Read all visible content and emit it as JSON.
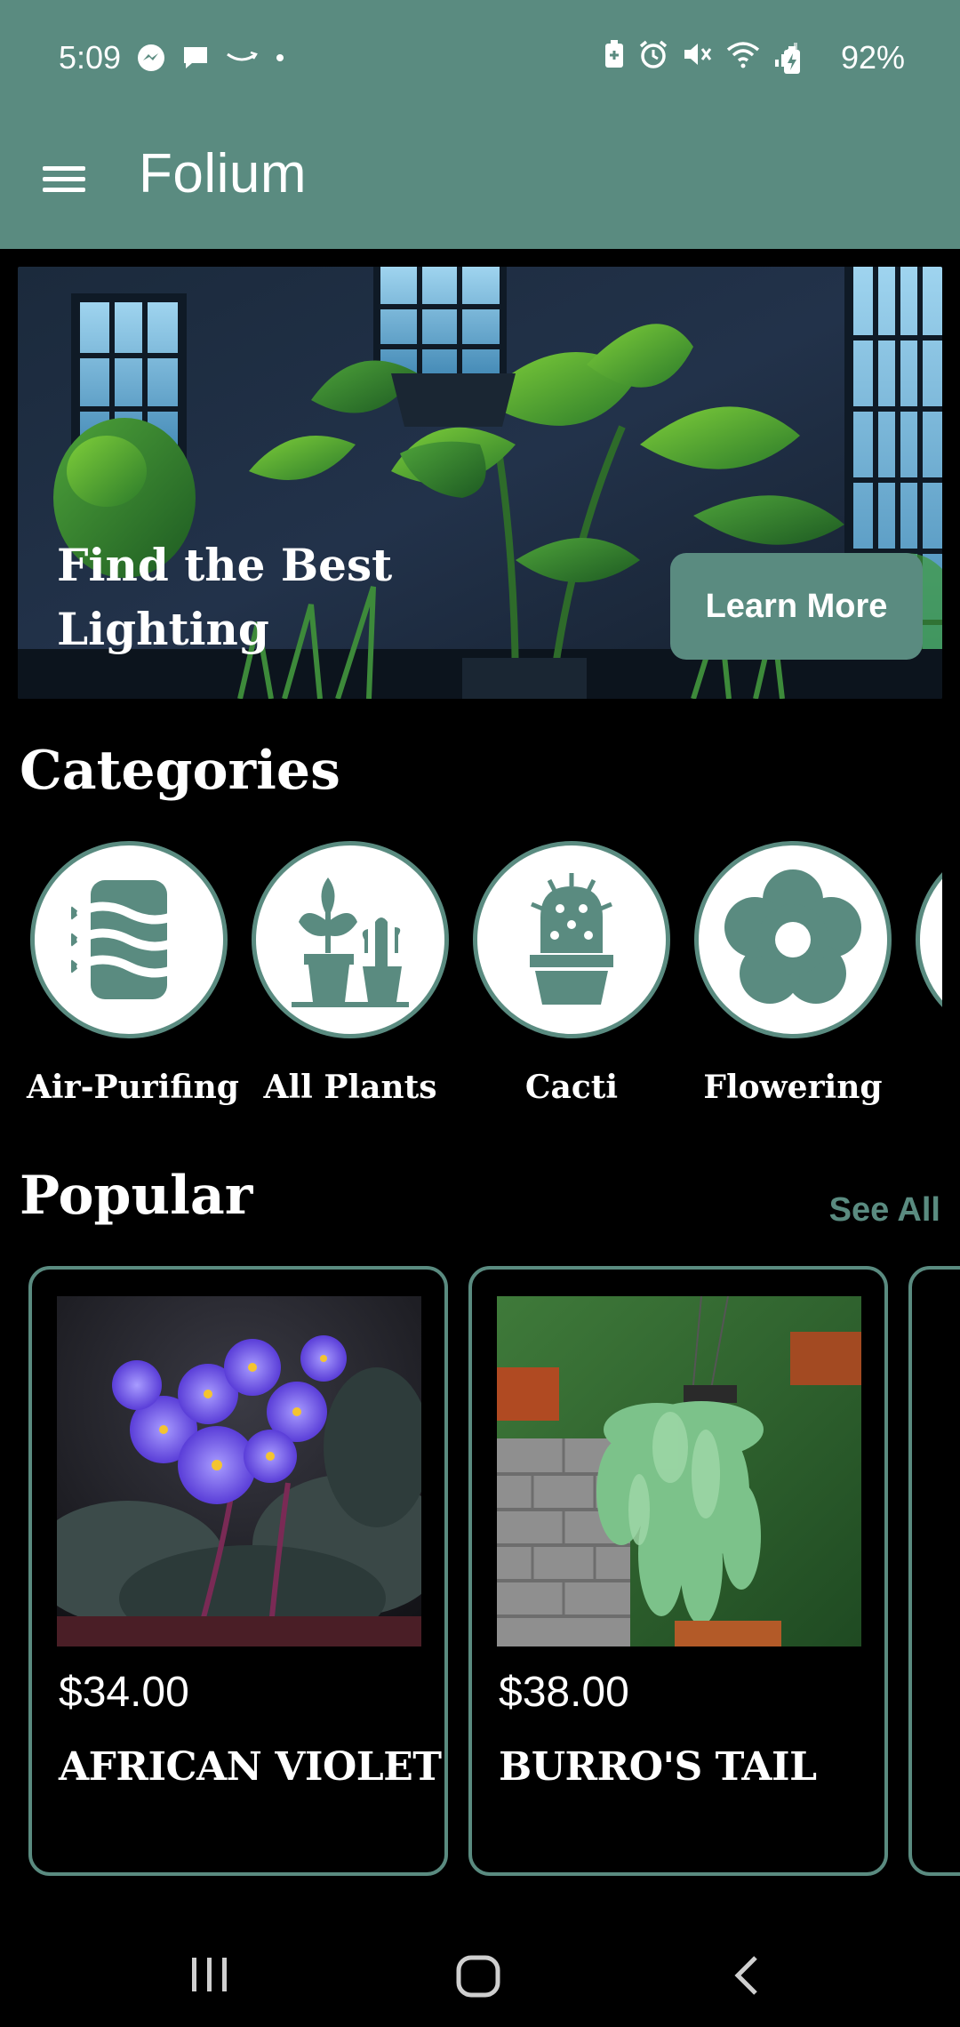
{
  "status_bar": {
    "time": "5:09",
    "battery": "92%",
    "icons": [
      "messenger-icon",
      "chat-icon",
      "amazon-icon",
      "dot-icon",
      "battery-saver-icon",
      "alarm-icon",
      "mute-icon",
      "wifi-icon",
      "signal-icon",
      "battery-icon"
    ]
  },
  "app_bar": {
    "title": "Folium",
    "menu_icon": "hamburger-menu-icon"
  },
  "hero": {
    "title": "Find the Best Lighting",
    "button": "Learn More"
  },
  "categories": {
    "title": "Categories",
    "items": [
      {
        "label": "Air-Purifing",
        "icon": "air-purifying-icon"
      },
      {
        "label": "All Plants",
        "icon": "plants-icon"
      },
      {
        "label": "Cacti",
        "icon": "cactus-icon"
      },
      {
        "label": "Flowering",
        "icon": "flower-icon"
      }
    ]
  },
  "popular": {
    "title": "Popular",
    "see_all": "See All",
    "items": [
      {
        "price": "$34.00",
        "name": "AFRICAN VIOLET"
      },
      {
        "price": "$38.00",
        "name": "BURRO'S TAIL"
      }
    ]
  },
  "colors": {
    "accent": "#5a8b80",
    "background": "#000000",
    "text": "#ffffff"
  }
}
